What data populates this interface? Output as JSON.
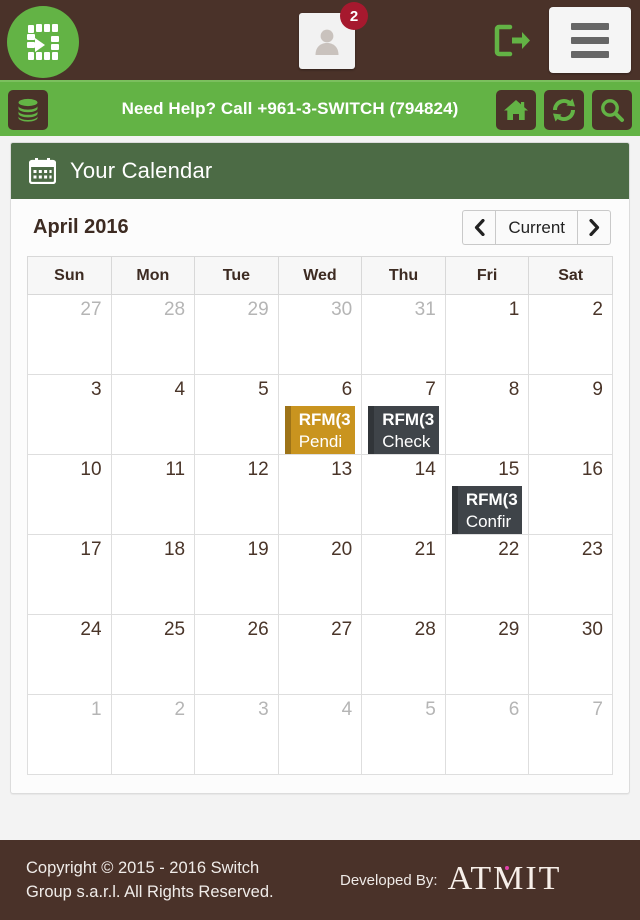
{
  "topbar": {
    "logo_alt": "Switch logo",
    "user_badge_count": "2",
    "signout_label": "Sign Out",
    "menu_label": "Menu"
  },
  "helpbar": {
    "text": "Need Help? Call +961-3-SWITCH (794824)",
    "database_label": "Database",
    "home_label": "Home",
    "refresh_label": "Refresh",
    "search_label": "Search"
  },
  "panel": {
    "title": "Your Calendar",
    "month_label": "April 2016",
    "nav": {
      "prev": "‹",
      "current": "Current",
      "next": "›"
    }
  },
  "calendar": {
    "weekdays": [
      "Sun",
      "Mon",
      "Tue",
      "Wed",
      "Thu",
      "Fri",
      "Sat"
    ],
    "weeks": [
      [
        {
          "day": "27",
          "off": true
        },
        {
          "day": "28",
          "off": true
        },
        {
          "day": "29",
          "off": true
        },
        {
          "day": "30",
          "off": true
        },
        {
          "day": "31",
          "off": true
        },
        {
          "day": "1",
          "off": false
        },
        {
          "day": "2",
          "off": false
        }
      ],
      [
        {
          "day": "3",
          "off": false
        },
        {
          "day": "4",
          "off": false
        },
        {
          "day": "5",
          "off": false
        },
        {
          "day": "6",
          "off": false,
          "event": {
            "title": "RFM(3",
            "sub": "Pendi",
            "color": "#c9941f"
          }
        },
        {
          "day": "7",
          "off": false,
          "event": {
            "title": "RFM(3",
            "sub": "Check",
            "color": "#3f4449"
          }
        },
        {
          "day": "8",
          "off": false
        },
        {
          "day": "9",
          "off": false
        }
      ],
      [
        {
          "day": "10",
          "off": false
        },
        {
          "day": "11",
          "off": false
        },
        {
          "day": "12",
          "off": false
        },
        {
          "day": "13",
          "off": false
        },
        {
          "day": "14",
          "off": false
        },
        {
          "day": "15",
          "off": false,
          "event": {
            "title": "RFM(3",
            "sub": "Confir",
            "color": "#3f4449"
          }
        },
        {
          "day": "16",
          "off": false
        }
      ],
      [
        {
          "day": "17",
          "off": false
        },
        {
          "day": "18",
          "off": false,
          "today": true
        },
        {
          "day": "19",
          "off": false
        },
        {
          "day": "20",
          "off": false
        },
        {
          "day": "21",
          "off": false
        },
        {
          "day": "22",
          "off": false
        },
        {
          "day": "23",
          "off": false
        }
      ],
      [
        {
          "day": "24",
          "off": false
        },
        {
          "day": "25",
          "off": false
        },
        {
          "day": "26",
          "off": false
        },
        {
          "day": "27",
          "off": false
        },
        {
          "day": "28",
          "off": false
        },
        {
          "day": "29",
          "off": false
        },
        {
          "day": "30",
          "off": false
        }
      ],
      [
        {
          "day": "1",
          "off": true
        },
        {
          "day": "2",
          "off": true
        },
        {
          "day": "3",
          "off": true
        },
        {
          "day": "4",
          "off": true
        },
        {
          "day": "5",
          "off": true
        },
        {
          "day": "6",
          "off": true
        },
        {
          "day": "7",
          "off": true
        }
      ]
    ]
  },
  "footer": {
    "copyright_line1": "Copyright © 2015 - 2016 Switch",
    "copyright_line2": "Group s.a.r.l. All Rights Reserved.",
    "developed_by_label": "Developed By:",
    "developer_name": "ATMIT"
  },
  "colors": {
    "brand_brown": "#4a3229",
    "brand_green": "#63b345",
    "panel_green": "#4c6b45",
    "badge_red": "#a6192e",
    "event_orange": "#c9941f",
    "event_dark": "#3f4449",
    "today_yellow": "#fcfadf"
  }
}
